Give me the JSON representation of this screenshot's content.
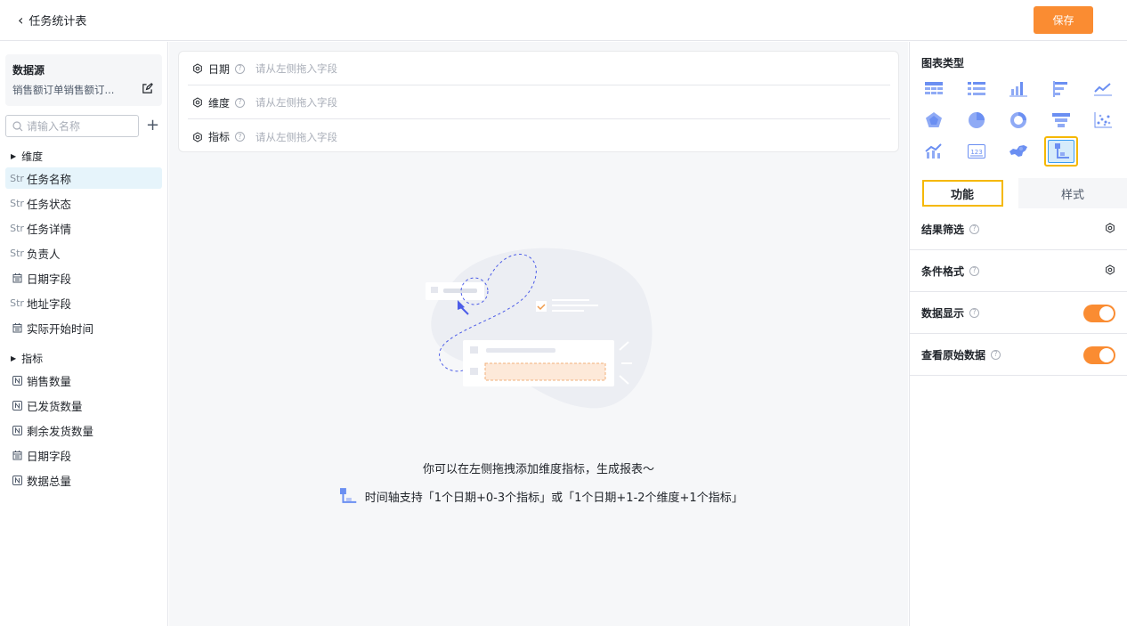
{
  "header": {
    "title": "任务统计表",
    "save_label": "保存"
  },
  "sidebar": {
    "datasource_title": "数据源",
    "datasource_name": "销售额订单销售额订...",
    "search_placeholder": "请输入名称",
    "dim_group": "维度",
    "dimensions": [
      {
        "type": "Str",
        "label": "任务名称"
      },
      {
        "type": "Str",
        "label": "任务状态"
      },
      {
        "type": "Str",
        "label": "任务详情"
      },
      {
        "type": "Str",
        "label": "负责人"
      },
      {
        "type": "date",
        "label": "日期字段"
      },
      {
        "type": "Str",
        "label": "地址字段"
      },
      {
        "type": "date",
        "label": "实际开始时间"
      }
    ],
    "metric_group": "指标",
    "metrics": [
      {
        "type": "N",
        "label": "销售数量"
      },
      {
        "type": "N",
        "label": "已发货数量"
      },
      {
        "type": "N",
        "label": "剩余发货数量"
      },
      {
        "type": "date",
        "label": "日期字段"
      },
      {
        "type": "N",
        "label": "数据总量"
      }
    ]
  },
  "shelves": [
    {
      "label": "日期",
      "placeholder": "请从左侧拖入字段"
    },
    {
      "label": "维度",
      "placeholder": "请从左侧拖入字段"
    },
    {
      "label": "指标",
      "placeholder": "请从左侧拖入字段"
    }
  ],
  "empty_state": {
    "hint": "你可以在左侧拖拽添加维度指标，生成报表～",
    "timeline_hint": "时间轴支持「1个日期+0-3个指标」或「1个日期+1-2个维度+1个指标」"
  },
  "right_panel": {
    "chart_type_title": "图表类型",
    "chart_icons": [
      "table-icon",
      "list-icon",
      "bar-chart-icon",
      "horizontal-bar-icon",
      "line-chart-icon",
      "radar-icon",
      "pie-icon",
      "donut-icon",
      "funnel-icon",
      "scatter-icon",
      "combo-chart-icon",
      "number-card-icon",
      "map-icon",
      "timeline-icon"
    ],
    "selected_chart": "timeline-icon",
    "tab_function": "功能",
    "tab_style": "样式",
    "options": [
      {
        "label": "结果筛选",
        "control": "settings"
      },
      {
        "label": "条件格式",
        "control": "settings"
      },
      {
        "label": "数据显示",
        "control": "toggle",
        "on": true
      },
      {
        "label": "查看原始数据",
        "control": "toggle",
        "on": true
      }
    ]
  },
  "colors": {
    "accent": "#fa8c32",
    "selected_border": "#f5b800",
    "icon_blue": "#6b8ff2"
  }
}
